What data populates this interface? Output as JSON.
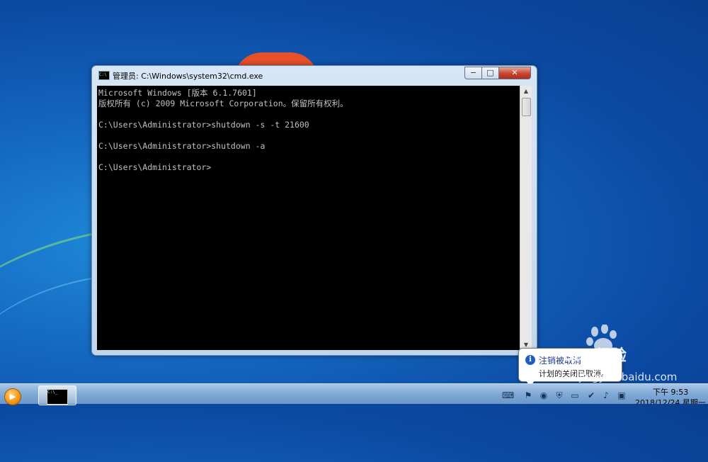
{
  "window": {
    "title": "管理员: C:\\Windows\\system32\\cmd.exe",
    "icon_name": "cmd-icon",
    "buttons": {
      "minimize": "−",
      "maximize": "□",
      "close": "✕"
    }
  },
  "console": {
    "lines": [
      "Microsoft Windows [版本 6.1.7601]",
      "版权所有 (c) 2009 Microsoft Corporation。保留所有权利。",
      "",
      "C:\\Users\\Administrator>shutdown -s -t 21600",
      "",
      "C:\\Users\\Administrator>shutdown -a",
      "",
      "C:\\Users\\Administrator>"
    ]
  },
  "notification": {
    "title": "注销被取消",
    "body": "计划的关闭已取消。",
    "icon_name": "info-icon"
  },
  "watermark": {
    "text": "Bai 经验",
    "sub": "jingyan.baidu.com"
  },
  "taskbar": {
    "start_icon": "media-player-icon",
    "task_item_label": "C:\\_",
    "tray_icons": [
      "keyboard-icon",
      "flag-icon",
      "security-icon",
      "shield-icon",
      "monitor-icon",
      "network-shield-icon",
      "volume-icon",
      "network-icon"
    ],
    "clock_time": "下午 9:53",
    "clock_date": "2018/12/24 星期一"
  },
  "colors": {
    "console_bg": "#000000",
    "console_text": "#c0c0c0",
    "taskbar": "#7fa9d6",
    "close_button": "#c7452f"
  }
}
